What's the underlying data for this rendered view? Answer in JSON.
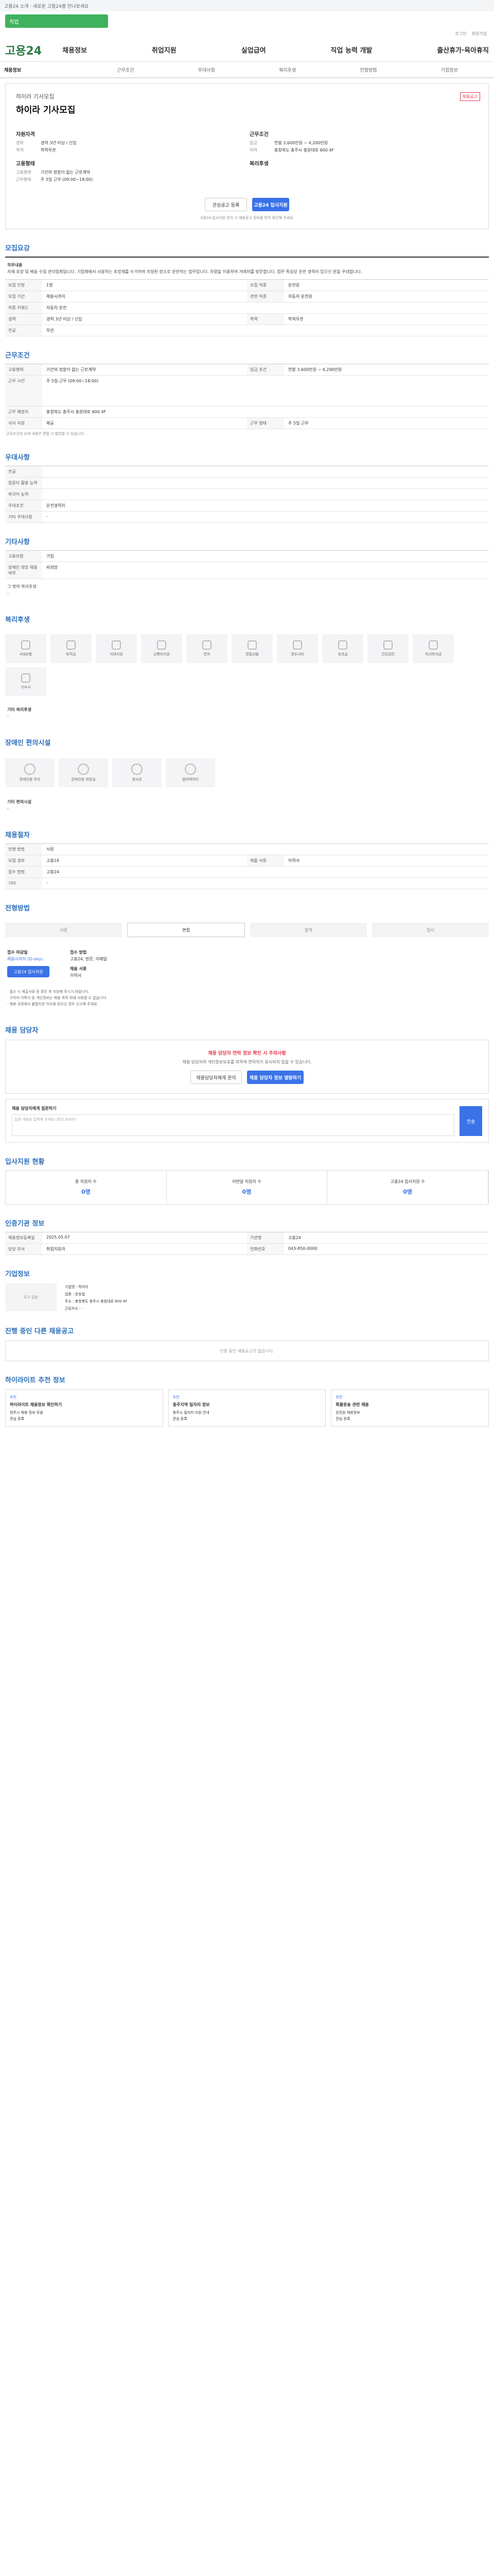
{
  "top": {
    "notice": "고용24 소개 · 새로운 고용24를 만나보세요"
  },
  "search": {
    "placeholder": "직업"
  },
  "util": [
    "로그인",
    "회원가입"
  ],
  "gnb": {
    "logo": "고용24",
    "menu": [
      "채용정보",
      "취업지원",
      "실업급여",
      "직업 능력 개발",
      "출산휴가·육아휴직"
    ]
  },
  "tabs": [
    "채용정보",
    "근무조건",
    "우대사항",
    "복리후생",
    "전형방법",
    "기업정보"
  ],
  "job": {
    "company": "하이라 기사모집",
    "title": "하이라 기사모집",
    "badge": "채용공고",
    "sum_left_h": "자원자격",
    "sum_left": [
      [
        "경력",
        "경력 3년 이상 / 신입"
      ],
      [
        "학력",
        "학력무관"
      ]
    ],
    "sum_right_h": "근무조건",
    "sum_right": [
      [
        "임금",
        "연봉 3,600만원 ~ 4,200만원"
      ],
      [
        "지역",
        "충청북도 충주시 충원대로 600 4F"
      ]
    ],
    "emp_h": "고용형태",
    "emp": [
      [
        "고용형태",
        "기간의 정함이 없는 근로계약"
      ],
      [
        "근무형태",
        "주 5일 근무 (09:00~18:00)"
      ]
    ],
    "welfare_h": "복리후생",
    "btn_save": "관심공고 등록",
    "btn_apply": "고용24 입사지원",
    "note": "고용24 입사지원 문의 시 채용공고 정보를 먼저 확인해 주세요."
  },
  "s1": {
    "h": "모집요강",
    "title": "직무내용",
    "body": "자재 포장 및 배송 수집 관리업체입니다. 기업체에서 사용하는 포장재를 수거하여 지정된 장소로 운반하는 업무입니다. 차량을 이용하여 거래처를 방문합니다. 업무 특성상 운전 경력이 있으신 분을 우대합니다.",
    "rows": [
      [
        "모집 인원",
        "1명",
        "모집 직종",
        "운전원"
      ],
      [
        "모집 기간",
        "채용시까지",
        "관련 직종",
        "자동차 운전원"
      ],
      [
        "직종 키워드",
        "자동차 운전",
        "",
        ""
      ],
      [
        "경력",
        "경력 3년 이상 / 신입",
        "학력",
        "학력무관"
      ],
      [
        "전공",
        "무관",
        "",
        ""
      ]
    ]
  },
  "s2": {
    "h": "근무조건",
    "rows": [
      [
        "고용형태",
        "기간의 정함이 없는 근로계약",
        "임금 조건",
        "연봉 3,600만원 ~ 4,200만원"
      ],
      [
        "근무 시간",
        "주 5일 근무 (09:00~18:00)",
        "",
        ""
      ],
      [
        "근무 예정지",
        "충청북도 충주시 충원대로 600 4F",
        "",
        ""
      ],
      [
        "식사 지원",
        "제공",
        "근무 형태",
        "주 5일 근무"
      ]
    ],
    "note": "근로조건의 상세 내용은 면접 시 협의할 수 있습니다."
  },
  "s3": {
    "h": "우대사항",
    "rows": [
      [
        "전공",
        ""
      ],
      [
        "컴퓨터 활용 능력",
        ""
      ],
      [
        "외국어 능력",
        ""
      ],
      [
        "우대조건",
        "운전경력자"
      ],
      [
        "기타 우대사항",
        "-"
      ]
    ]
  },
  "s4": {
    "h": "기타사항",
    "rows": [
      [
        "고용보험",
        "가입"
      ],
      [
        "장애인 희망 채용여부",
        "비희망"
      ]
    ],
    "note": "그 밖의 복리후생",
    "n2": "-"
  },
  "s5": {
    "h": "복리후생",
    "items": [
      "4대보험",
      "퇴직금",
      "식대지원",
      "교통비지원",
      "연차",
      "명절선물",
      "경조사비",
      "성과급",
      "건강검진",
      "자녀학자금",
      "기숙사"
    ],
    "sub": "기타 복리후생",
    "v": "-"
  },
  "s6": {
    "h": "장애인 편의시설",
    "items": [
      "장애인용 주차",
      "장애인용 화장실",
      "경사로",
      "엘리베이터"
    ],
    "sub": "기타 편의시설",
    "v": "-"
  },
  "s7": {
    "h": "채용절차",
    "rows": [
      [
        "전형 방법",
        "서류"
      ],
      [
        "모집 경로",
        "고용24",
        "제출 서류",
        "이력서"
      ],
      [
        "접수 방법",
        "고용24",
        "",
        ""
      ],
      [
        "기타",
        "-",
        "",
        ""
      ]
    ]
  },
  "s8": {
    "h": "전형방법",
    "steps": [
      "서류",
      "면접",
      "합격",
      "입사"
    ],
    "c1h": "접수 마감일",
    "c1": "채용시까지 (D-day)",
    "c2h": "접수 방법",
    "c2": "고용24, 방문, 이메일",
    "c3h": "채용 서류",
    "c3": "이력서",
    "apply": "고용24 입사지원",
    "bullets": [
      "· 접수 시 제출서류 등 확인 후 지원해 주시기 바랍니다.",
      "· 구직자 이력서 등 개인정보는 채용 목적 외에 사용할 수 없습니다.",
      "· 채용 과정에서 불합리한 처우를 받으신 경우 신고해 주세요."
    ]
  },
  "s9": {
    "h": "채용 담당자",
    "ibox_h": "채용 담당자 연락 정보 확인 시 주의사항",
    "ibox_d": "채용 담당자의 개인정보보호를 위하여 연락처가 표시되지 않을 수 있습니다.",
    "b1": "채용담당자에게 문의",
    "b2": "채용 담당자 정보 열람하기",
    "qh": "채용 담당자에게 질문하기",
    "qph": "질문 내용을 입력해 주세요 (최대 300자)",
    "qbtn": "전송"
  },
  "s10": {
    "h": "입사지원 현황",
    "stats": [
      [
        "총 지원자 수",
        "0명"
      ],
      [
        "이번달 지원자 수",
        "0명"
      ],
      [
        "고용24 입사지원 수",
        "0명"
      ]
    ]
  },
  "s11": {
    "h": "인증기관 정보",
    "rows": [
      [
        "채용정보등록일",
        "2025.05.07",
        "기관명",
        "고용24"
      ],
      [
        "담당 부서",
        "취업지원과",
        "전화번호",
        "043-850-0000"
      ]
    ]
  },
  "s12": {
    "h": "기업정보",
    "logo": "로고 없음",
    "rows": [
      [
        "기업명",
        "하이라"
      ],
      [
        "업종",
        "운송업"
      ],
      [
        "주소",
        "충청북도 충주시 충원대로 600 4F"
      ],
      [
        "근로자수",
        "-"
      ]
    ]
  },
  "s13": {
    "h": "진행 중인 다른 채용공고",
    "empty": "진행 중인 채용공고가 없습니다."
  },
  "s14": {
    "h": "하이라이트 추천 정보",
    "recs": [
      [
        "추천",
        "하이라이트 채용정보 확인하기",
        "청주시 채용 정보 모음",
        "관심 등록"
      ],
      [
        "추천",
        "충주지역 일자리 정보",
        "충주시 일자리 지원 안내",
        "관심 등록"
      ],
      [
        "추천",
        "화물운송 관련 채용",
        "운전원 채용정보",
        "관심 등록"
      ]
    ]
  }
}
